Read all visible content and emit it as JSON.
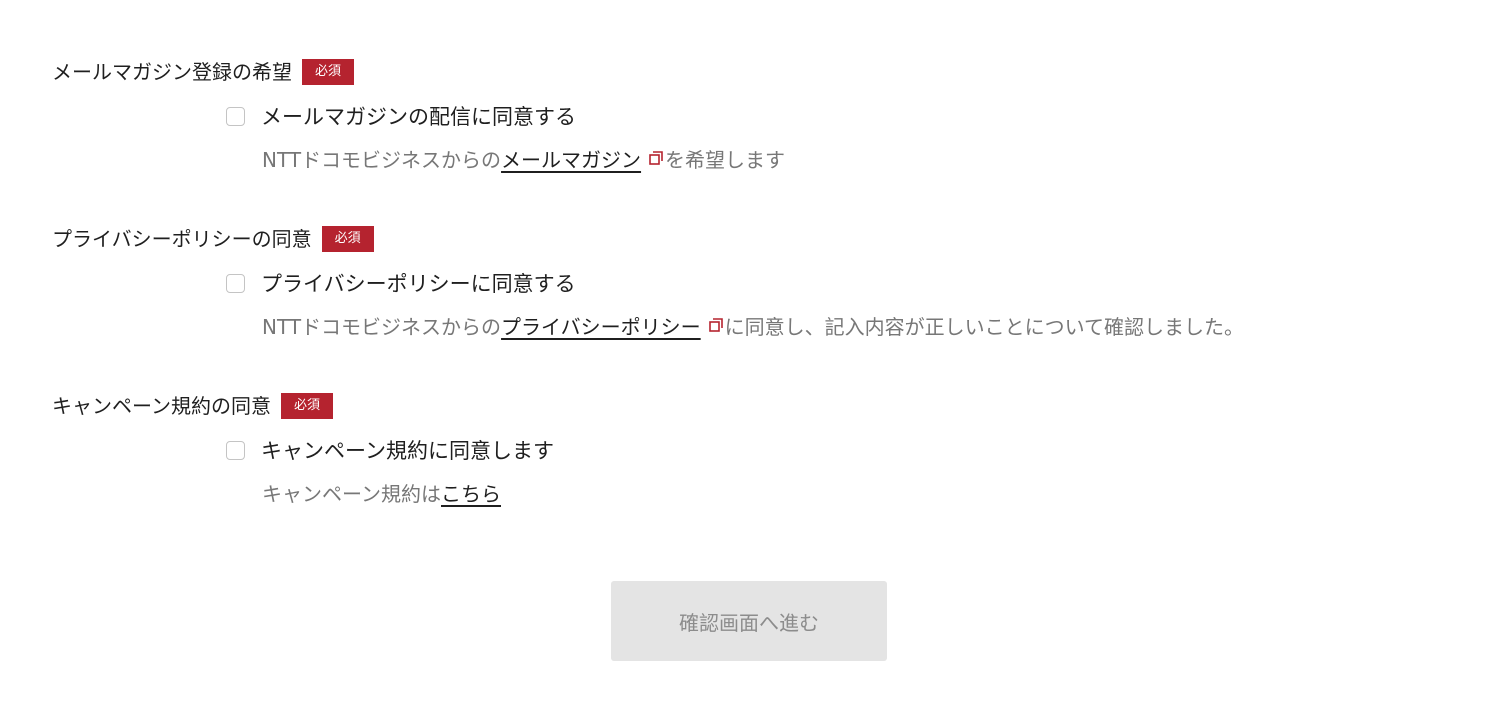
{
  "sections": [
    {
      "title": "メールマガジン登録の希望",
      "badge": "必須",
      "checkbox_label": "メールマガジンの配信に同意する",
      "note_before": "NTTドコモビジネスからの",
      "note_link": "メールマガジン",
      "note_after": "を希望します",
      "checked": false
    },
    {
      "title": "プライバシーポリシーの同意",
      "badge": "必須",
      "checkbox_label": "プライバシーポリシーに同意する",
      "note_before": "NTTドコモビジネスからの",
      "note_link": "プライバシーポリシー",
      "note_after": "に同意し、記入内容が正しいことについて確認しました。",
      "checked": false
    },
    {
      "title": "キャンペーン規約の同意",
      "badge": "必須",
      "checkbox_label": "キャンペーン規約に同意します",
      "note_before": "キャンペーン規約は",
      "note_link": "こちら",
      "checked": false
    }
  ],
  "submit": {
    "label": "確認画面へ進む",
    "disabled": true
  },
  "colors": {
    "badge_bg": "#b5232f",
    "text": "#1f1f1f",
    "muted_text": "#777777",
    "button_bg": "#e4e4e4",
    "button_text": "#8c8c8c"
  },
  "icons": {
    "external_link": "external-link-icon"
  }
}
